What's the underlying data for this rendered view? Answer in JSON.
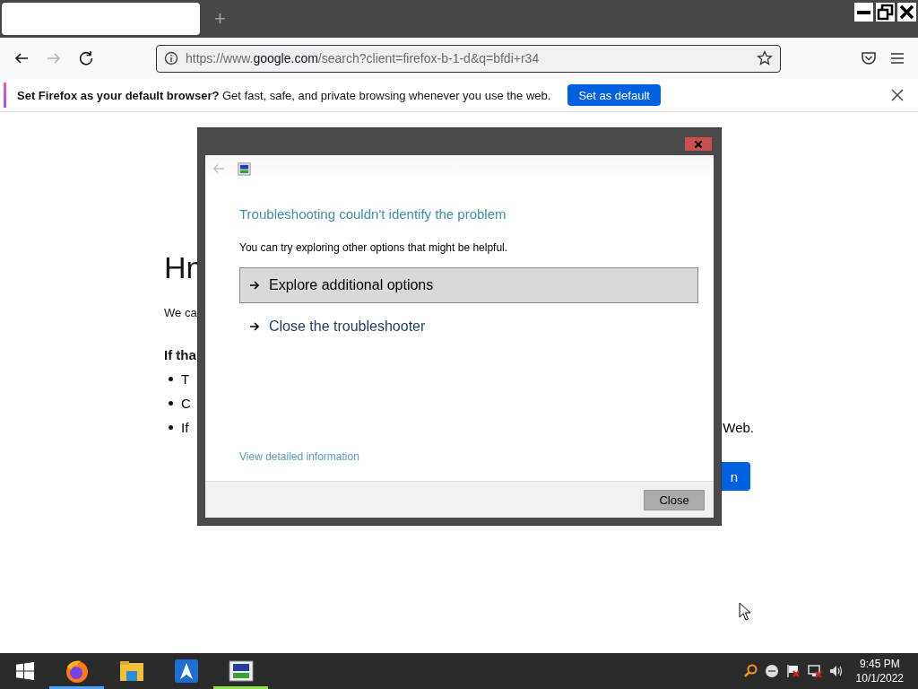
{
  "browser": {
    "tab": {
      "selected": true
    },
    "new_tab": "+",
    "url": {
      "prefix": "https://www.",
      "host": "google.com",
      "path": "/search?client=firefox-b-1-d&q=bfdi+r34"
    },
    "nav": {
      "back_disabled": false,
      "forward_disabled": true
    },
    "notification": {
      "message": "**Set Firefox as your default browser?** Get fast, safe, and private browsing whenever you use the web.",
      "button": "Set as default"
    }
  },
  "page": {
    "heading": "Hn",
    "paragraph": "We ca",
    "bold_line": "If tha",
    "bullets": [
      "T",
      "C",
      "If"
    ],
    "bullet_tail": "Web.",
    "button": "n"
  },
  "dialog": {
    "back_disabled": true,
    "heading": "Troubleshooting couldn't identify the problem",
    "subtext": "You can try exploring other options that might be helpful.",
    "options": [
      {
        "label": "Explore additional options",
        "selected": true
      },
      {
        "label": "Close the troubleshooter",
        "selected": false
      }
    ],
    "link": "View detailed information",
    "close_button": "Close"
  },
  "taskbar": {
    "apps": [
      {
        "kind": "firefox",
        "running": true,
        "color": "#4aa3ff"
      },
      {
        "kind": "folder",
        "running": false
      },
      {
        "kind": "letter",
        "running": false
      },
      {
        "kind": "troubleshooter",
        "running": true,
        "color": "#8ee04a"
      }
    ],
    "time": "9:45 PM",
    "date": "10/1/2022"
  }
}
